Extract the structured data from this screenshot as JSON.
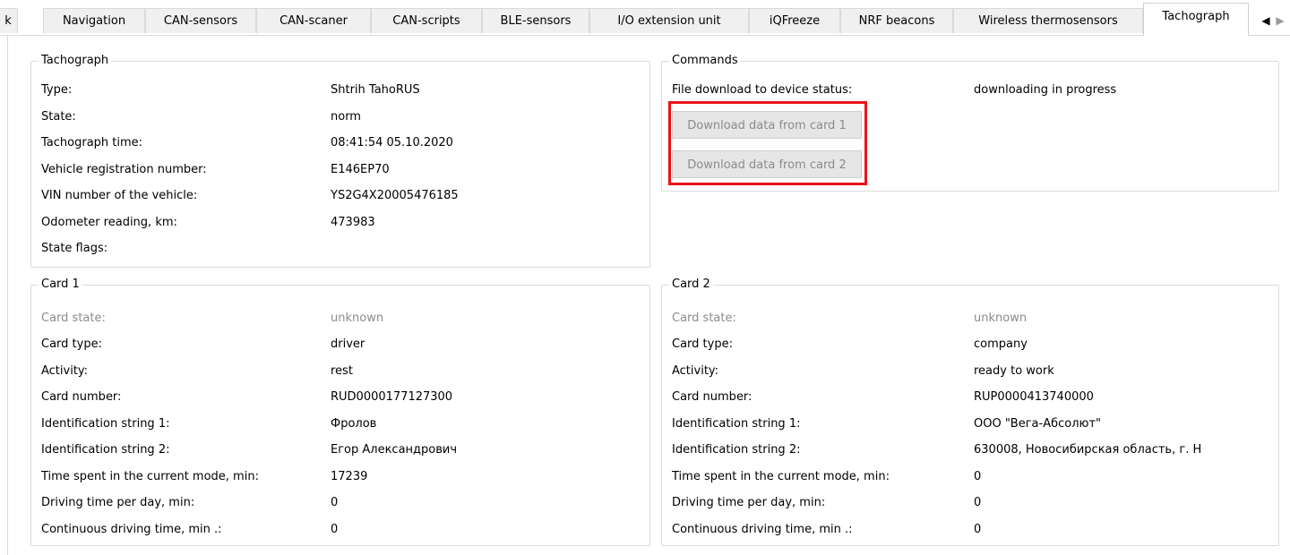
{
  "tabs": [
    {
      "label": "k"
    },
    {
      "label": "Navigation"
    },
    {
      "label": "CAN-sensors"
    },
    {
      "label": "CAN-scaner"
    },
    {
      "label": "CAN-scripts"
    },
    {
      "label": "BLE-sensors"
    },
    {
      "label": "I/O extension unit"
    },
    {
      "label": "iQFreeze"
    },
    {
      "label": "NRF beacons"
    },
    {
      "label": "Wireless thermosensors"
    },
    {
      "label": "Tachograph"
    }
  ],
  "scroll": {
    "left": "◀",
    "right": "▶"
  },
  "tachograph": {
    "title": "Tachograph",
    "rows": [
      {
        "label": "Type:",
        "value": "Shtrih TahoRUS"
      },
      {
        "label": "State:",
        "value": "norm"
      },
      {
        "label": "Tachograph time:",
        "value": "08:41:54 05.10.2020"
      },
      {
        "label": "Vehicle registration number:",
        "value": "E146EP70"
      },
      {
        "label": "VIN number of the vehicle:",
        "value": "YS2G4X20005476185"
      },
      {
        "label": "Odometer reading, km:",
        "value": "473983"
      },
      {
        "label": "State flags:",
        "value": ""
      }
    ]
  },
  "commands": {
    "title": "Commands",
    "status_label": "File download to device status:",
    "status_value": "downloading in progress",
    "download_card1": "Download data from card 1",
    "download_card2": "Download data from card 2"
  },
  "card1": {
    "title": "Card 1",
    "rows": [
      {
        "label": "Card state:",
        "value": "unknown"
      },
      {
        "label": "Card type:",
        "value": "driver"
      },
      {
        "label": "Activity:",
        "value": "rest"
      },
      {
        "label": "Card number:",
        "value": "RUD0000177127300"
      },
      {
        "label": "Identification string 1:",
        "value": "Фролов"
      },
      {
        "label": "Identification string 2:",
        "value": "Егор Александрович"
      },
      {
        "label": "Time spent in the current mode, min:",
        "value": "17239"
      },
      {
        "label": "Driving time per day, min:",
        "value": "0"
      },
      {
        "label": "Continuous driving time, min .:",
        "value": "0"
      }
    ]
  },
  "card2": {
    "title": "Card 2",
    "rows": [
      {
        "label": "Card state:",
        "value": "unknown"
      },
      {
        "label": "Card type:",
        "value": "company"
      },
      {
        "label": "Activity:",
        "value": "ready to work"
      },
      {
        "label": "Card number:",
        "value": "RUP0000413740000"
      },
      {
        "label": "Identification string 1:",
        "value": "ООО \"Вега-Абсолют\""
      },
      {
        "label": "Identification string 2:",
        "value": "630008, Новосибирская область, г. Н"
      },
      {
        "label": "Time spent in the current mode, min:",
        "value": "0"
      },
      {
        "label": "Driving time per day, min:",
        "value": "0"
      },
      {
        "label": "Continuous driving time, min .:",
        "value": "0"
      }
    ]
  },
  "colors": {
    "highlight": "#e8131a",
    "disabled_text": "#8b8b8b"
  }
}
